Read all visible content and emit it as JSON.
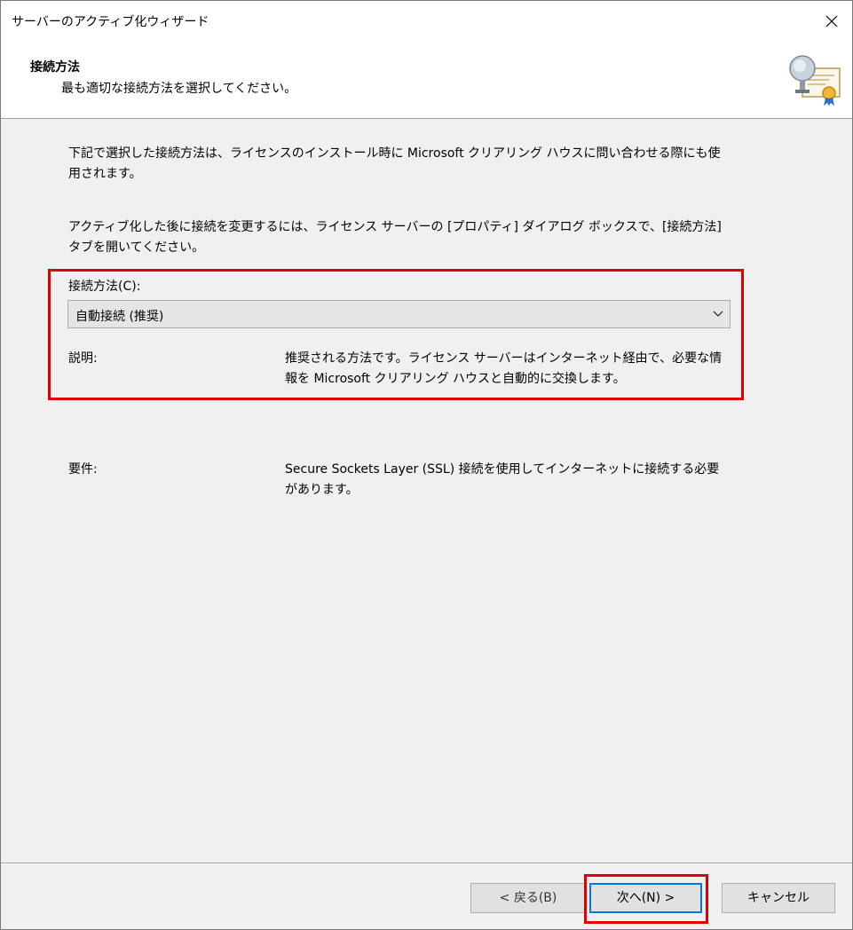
{
  "window": {
    "title": "サーバーのアクティブ化ウィザード"
  },
  "header": {
    "title": "接続方法",
    "subtitle": "最も適切な接続方法を選択してください。",
    "icon": "certificate-icon"
  },
  "main": {
    "paragraph1": "下記で選択した接続方法は、ライセンスのインストール時に Microsoft クリアリング ハウスに問い合わせる際にも使用されます。",
    "paragraph2": "アクティブ化した後に接続を変更するには、ライセンス サーバーの [プロパティ] ダイアログ ボックスで、[接続方法] タブを開いてください。",
    "connection_label": "接続方法(C):",
    "connection_value": "自動接続 (推奨)",
    "description_label": "説明:",
    "description_text": "推奨される方法です。ライセンス サーバーはインターネット経由で、必要な情報を Microsoft クリアリング ハウスと自動的に交換します。",
    "requirements_label": "要件:",
    "requirements_text": "Secure Sockets Layer (SSL) 接続を使用してインターネットに接続する必要があります。"
  },
  "footer": {
    "back_label": "< 戻る(B)",
    "next_label": "次へ(N) >",
    "cancel_label": "キャンセル"
  },
  "colors": {
    "highlight": "#e00000",
    "focus": "#0078d7",
    "dialog_bg": "#f0f0f0"
  }
}
